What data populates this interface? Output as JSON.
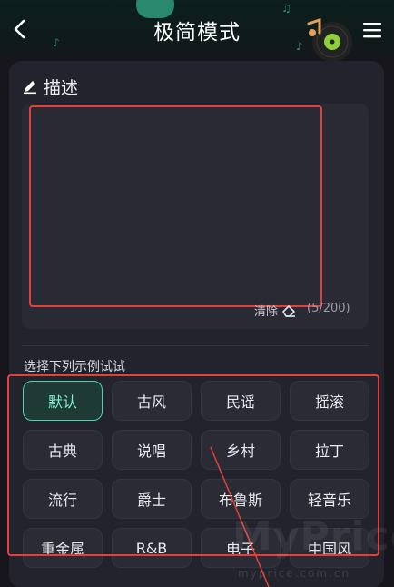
{
  "header": {
    "title": "极简模式",
    "back_icon": "chevron-left-icon",
    "menu_icon": "hamburger-menu-icon"
  },
  "description": {
    "heading": "描述",
    "heading_icon": "pencil-icon",
    "input_value": "",
    "clear_label": "清除",
    "clear_icon": "eraser-icon",
    "counter": "(5/200)"
  },
  "examples": {
    "label": "选择下列示例试试",
    "items": [
      {
        "label": "默认",
        "active": true
      },
      {
        "label": "古风",
        "active": false
      },
      {
        "label": "民谣",
        "active": false
      },
      {
        "label": "摇滚",
        "active": false
      },
      {
        "label": "古典",
        "active": false
      },
      {
        "label": "说唱",
        "active": false
      },
      {
        "label": "乡村",
        "active": false
      },
      {
        "label": "拉丁",
        "active": false
      },
      {
        "label": "流行",
        "active": false
      },
      {
        "label": "爵士",
        "active": false
      },
      {
        "label": "布鲁斯",
        "active": false
      },
      {
        "label": "轻音乐",
        "active": false
      },
      {
        "label": "重金属",
        "active": false
      },
      {
        "label": "R&B",
        "active": false
      },
      {
        "label": "电子",
        "active": false
      },
      {
        "label": "中国风",
        "active": false
      }
    ]
  },
  "watermark": {
    "text": "MyPrice",
    "sub": "myprice.com.cn"
  },
  "colors": {
    "accent": "#41d9b0",
    "highlight": "#e2403a",
    "background": "#16161c",
    "panel": "#23232d"
  }
}
